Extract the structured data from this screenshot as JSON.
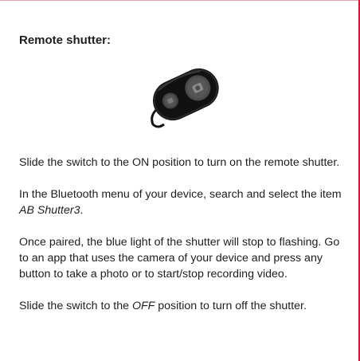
{
  "heading": "Remote shutter:",
  "device_image": {
    "icon": "bluetooth-remote-shutter",
    "colors": {
      "body": "#141414",
      "button": "#4a4a4a",
      "highlight": "#6d6d6d"
    }
  },
  "paragraphs": {
    "p1": "Slide the switch to the ON position to turn on the remote shutter.",
    "p2_prefix": "In the Bluetooth menu of your device, search and select the item ",
    "p2_item": "AB Shutter3",
    "p2_suffix": ".",
    "p3": "Once paired, the blue light of the shutter will stop to flashing. Go to an app that uses the camera of your device and press any button to take a photo or to start/stop recording video.",
    "p4_prefix": "Slide the switch to the ",
    "p4_off": "OFF",
    "p4_suffix": " position to turn off the shutter."
  },
  "accent_color": "#c8202f"
}
